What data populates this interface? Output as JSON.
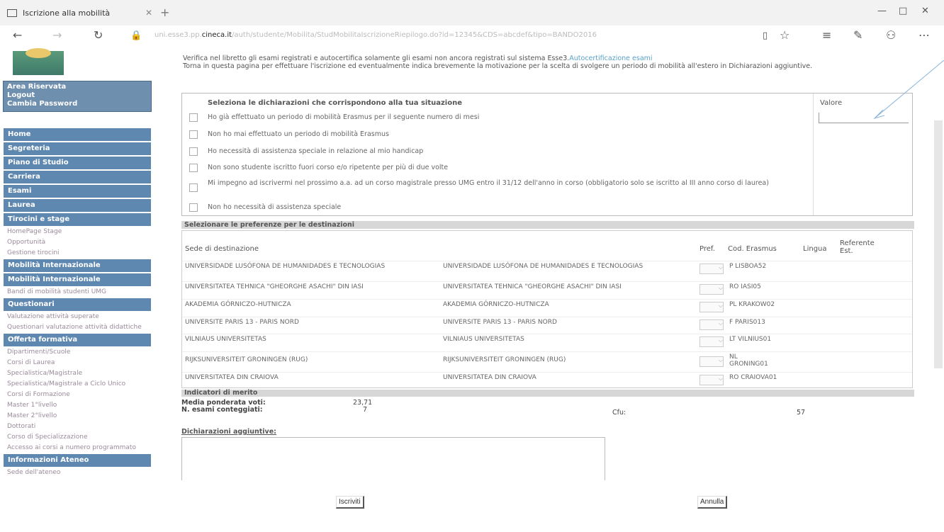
{
  "browser": {
    "tab_title": "Iscrizione alla mobilità",
    "url_prefix": "uni.esse3.pp.",
    "url_domain": "cineca.it",
    "url_rest": "/auth/studente/Mobilita/StudMobilitaIscrizioneRiepilogo.do?id=12345&CDS=abcdef&tipo=BANDO2016"
  },
  "sidebar": {
    "area": {
      "title": "Area Riservata",
      "logout": "Logout",
      "password": "Cambia Password"
    },
    "menu": [
      "Home",
      "Segreteria",
      "Piano di Studio",
      "Carriera",
      "Esami",
      "Laurea",
      "Tirocini e stage"
    ],
    "tirocini_sub": [
      "HomePage Stage",
      "Opportunità",
      "Gestione tirocini"
    ],
    "mob1": "Mobilità Internazionale",
    "mob2": "Mobilità Internazionale",
    "mob_sub": "Bandi di mobilità studenti UMG",
    "quest": "Questionari",
    "quest_sub": [
      "Valutazione attività superate",
      "Questionari valutazione attività didattiche"
    ],
    "offerta": "Offerta formativa",
    "offerta_sub": [
      "Dipartimenti/Scuole",
      "Corsi di Laurea",
      "Specialistica/Magistrale",
      "Specialistica/Magistrale a Ciclo Unico",
      "Corsi di Formazione",
      "Master 1°livello",
      "Master 2°livello",
      "Dottorati",
      "Corso di Specializzazione",
      "Accesso ai corsi a numero programmato"
    ],
    "info": "Informazioni Ateneo",
    "info_sub": "Sede dell'ateneo"
  },
  "intro": {
    "line1": "Verifica nel libretto gli esami registrati e autocertifica solamente gli esami non ancora registrati sul sistema Esse3.",
    "link": "Autocertificazione esami",
    "line2": "Torna in questa pagina per effettuare l'iscrizione ed eventualmente indica brevemente la motivazione per la scelta di svolgere un periodo di mobilità all'estero in Dichiarazioni aggiuntive."
  },
  "declarations": {
    "header": "Seleziona le dichiarazioni che corrispondono alla tua situazione",
    "value_header": "Valore",
    "items": [
      "Ho già effettuato un periodo di mobilità Erasmus per il seguente numero di mesi",
      "Non ho mai effettuato un periodo di mobilità Erasmus",
      "Ho necessità di assistenza speciale in relazione al mio handicap",
      "Non sono studente iscritto fuori corso e/o ripetente per più di due volte",
      "Mi impegno ad iscrivermi nel prossimo a.a. ad un corso magistrale presso UMG entro il 31/12 dell'anno in corso (obbligatorio solo se iscritto al III anno corso di laurea)",
      "Non ho necessità di assistenza speciale"
    ]
  },
  "destinations": {
    "section_title": "Selezionare le preferenze per le destinazioni",
    "col_sede": "Sede di destinazione",
    "col_pref": "Pref.",
    "col_cod": "Cod. Erasmus",
    "col_lingua": "Lingua",
    "col_ref": "Referente Est.",
    "rows": [
      {
        "a": "UNIVERSIDADE LUSÓFONA DE HUMANIDADES E TECNOLOGIAS",
        "b": "UNIVERSIDADE LUSÓFONA DE HUMANIDADES E TECNOLOGIAS",
        "code": "P LISBOA52"
      },
      {
        "a": "UNIVERSITATEA TEHNICA \"GHEORGHE ASACHI\" DIN IASI",
        "b": "UNIVERSITATEA TEHNICA \"GHEORGHE ASACHI\" DIN IASI",
        "code": "RO IASI05"
      },
      {
        "a": "AKADEMIA GÓRNICZO-HUTNICZA",
        "b": "AKADEMIA GÓRNICZO-HUTNICZA",
        "code": "PL KRAKOW02"
      },
      {
        "a": "UNIVERSITE PARIS 13 - PARIS NORD",
        "b": "UNIVERSITE PARIS 13 - PARIS NORD",
        "code": "F PARIS013"
      },
      {
        "a": "VILNIAUS UNIVERSITETAS",
        "b": "VILNIAUS UNIVERSITETAS",
        "code": "LT VILNIUS01"
      },
      {
        "a": "RIJKSUNIVERSITEIT GRONINGEN (RUG)",
        "b": "RIJKSUNIVERSITEIT GRONINGEN (RUG)",
        "code": "NL GRONING01"
      },
      {
        "a": "UNIVERSITATEA DIN CRAIOVA",
        "b": "UNIVERSITATEA DIN CRAIOVA",
        "code": "RO CRAIOVA01"
      }
    ]
  },
  "merit": {
    "title": "Indicatori di merito",
    "media_label": "Media ponderata voti:",
    "media_value": "23,71",
    "esami_label": "N. esami conteggiati:",
    "esami_value": "7",
    "cfu_label": "Cfu:",
    "cfu_value": "57"
  },
  "extra": {
    "label": "Dichiarazioni aggiuntive:"
  },
  "buttons": {
    "iscrivi": "Iscriviti",
    "annulla": "Annulla"
  }
}
